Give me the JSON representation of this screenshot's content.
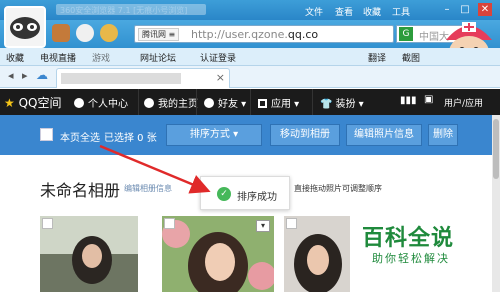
{
  "browser": {
    "title_text": "360安全浏览器 7.1 [无痕小号浏览]",
    "menus": [
      "文件",
      "查看",
      "收藏",
      "工具"
    ],
    "window_controls": [
      "minimize",
      "maximize",
      "close"
    ],
    "address_engine_tag": "腾讯网 ≡",
    "address_url_prefix": "http://user.qzone.",
    "address_url_bold": "qq.co",
    "search_placeholder": "中国大",
    "favorites": [
      "收藏",
      "电视直播",
      "游戏",
      "网址论坛",
      "认证登录",
      "翻译",
      "截图"
    ],
    "tab_close": "×"
  },
  "qzone_nav": {
    "logo": "QQ空间",
    "items": [
      "个人中心",
      "我的主页",
      "好友",
      "应用",
      "装扮"
    ],
    "right_link": "用户/应用"
  },
  "toolbar": {
    "select_all": "本页全选",
    "selected_count": "已选择 0 张",
    "sort_button": "排序方式 ▾",
    "move_button": "移动到相册",
    "edit_button": "编辑照片信息",
    "delete_button": "删除"
  },
  "content": {
    "album_title": "未命名相册",
    "edit_link": "编辑相册信息",
    "drag_hint": "直接拖动照片可调整顺序",
    "toast_text": "排序成功",
    "photo_dropdown": "▾"
  },
  "watermark": {
    "line1": "百科全说",
    "line2": "助你轻松解决"
  },
  "colors": {
    "chrome_blue": "#3191d0",
    "qzone_dark": "#1b1b1b",
    "toolbar_blue": "#3a86cf",
    "success_green": "#46b85a",
    "arrow_red": "#e02a2a"
  }
}
